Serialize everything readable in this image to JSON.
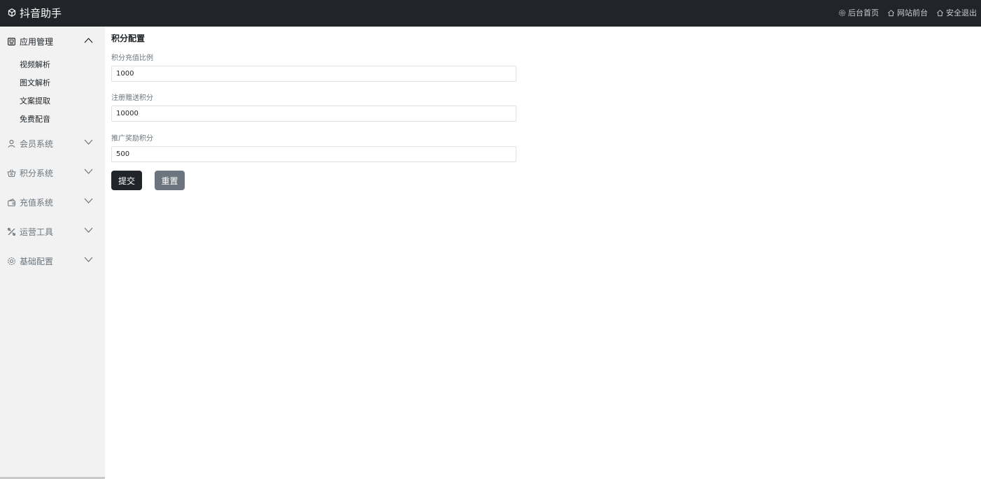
{
  "header": {
    "brand": "抖音助手",
    "links": [
      {
        "label": "后台首页",
        "icon": "gear-icon"
      },
      {
        "label": "网站前台",
        "icon": "home-icon"
      },
      {
        "label": "安全退出",
        "icon": "home-icon"
      }
    ]
  },
  "sidebar": {
    "groups": [
      {
        "label": "应用管理",
        "icon": "app-icon",
        "expanded": true,
        "items": [
          "视频解析",
          "图文解析",
          "文案提取",
          "免费配音"
        ]
      },
      {
        "label": "会员系统",
        "icon": "user-icon",
        "expanded": false
      },
      {
        "label": "积分系统",
        "icon": "basket-icon",
        "expanded": false
      },
      {
        "label": "充值系统",
        "icon": "wallet-icon",
        "expanded": false
      },
      {
        "label": "运营工具",
        "icon": "tools-icon",
        "expanded": false
      },
      {
        "label": "基础配置",
        "icon": "gear-icon",
        "expanded": false
      }
    ]
  },
  "main": {
    "title": "积分配置",
    "fields": [
      {
        "label": "积分充值比例",
        "value": "1000"
      },
      {
        "label": "注册赠送积分",
        "value": "10000"
      },
      {
        "label": "推广奖励积分",
        "value": "500"
      }
    ],
    "submit_label": "提交",
    "reset_label": "重置"
  },
  "colors": {
    "topbar": "#212529",
    "sidebar": "#f2f2f2",
    "primary_button": "#212529",
    "secondary_button": "#6c757d"
  }
}
